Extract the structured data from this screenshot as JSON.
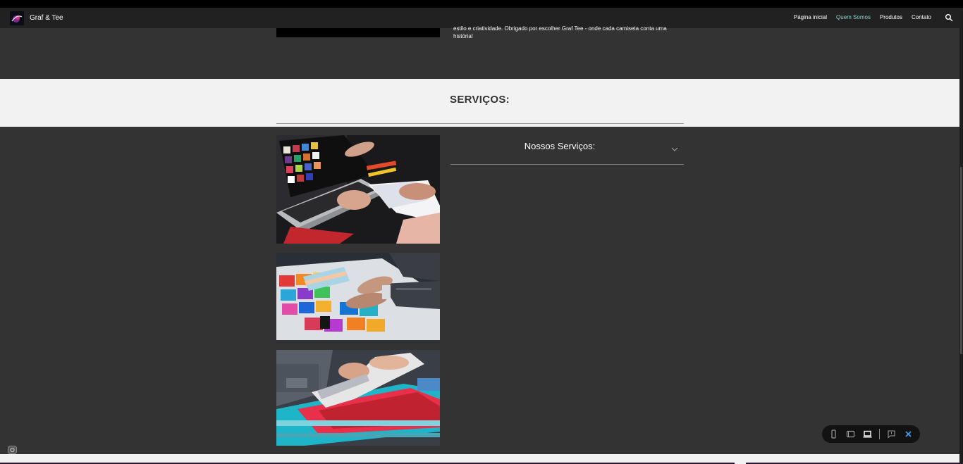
{
  "header": {
    "brand": "Graf & Tee",
    "nav": [
      {
        "label": "Página inicial",
        "active": false
      },
      {
        "label": "Quem Somos",
        "active": true
      },
      {
        "label": "Produtos",
        "active": false
      },
      {
        "label": "Contato",
        "active": false
      }
    ],
    "active_color": "#88d6c8"
  },
  "about": {
    "text": "estilo e criatividade. Obrigado por escolher Graf Tee - onde cada camiseta conta uma história!"
  },
  "services": {
    "title": "SERVIÇOS:",
    "accordion_label": "Nossos Serviços:"
  },
  "icons": {
    "search": "search-icon",
    "chevron": "chevron-down-icon",
    "camera": "camera-icon",
    "toolbar": [
      "mobile-view-icon",
      "tablet-view-icon",
      "laptop-view-icon",
      "feedback-icon",
      "close-icon"
    ]
  },
  "colors": {
    "page_background": "#333333",
    "navbar": "#212121",
    "services_band": "#f2f2f2",
    "close_accent": "#3aa0ff"
  }
}
